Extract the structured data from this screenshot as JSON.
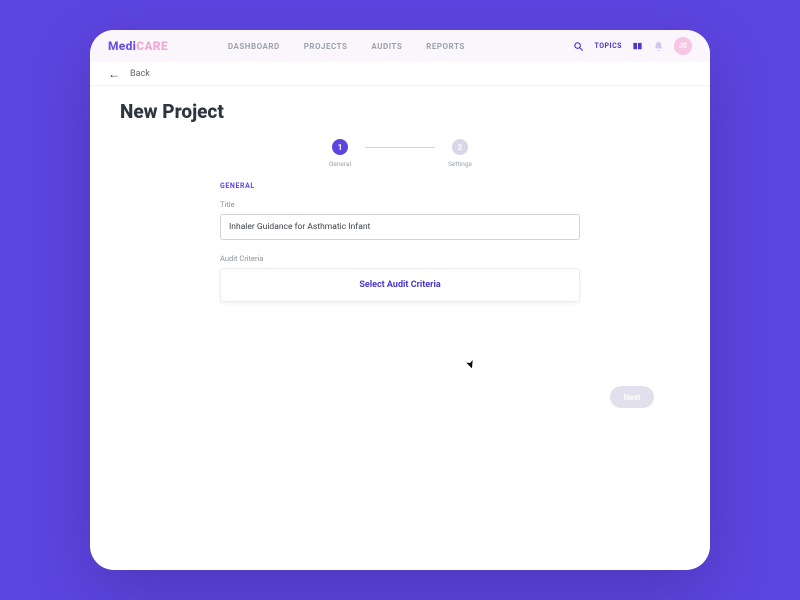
{
  "brand": {
    "part1": "Medi",
    "part2": "CARE"
  },
  "nav": {
    "dashboard": "DASHBOARD",
    "projects": "PROJECTS",
    "audits": "AUDITS",
    "reports": "REPORTS"
  },
  "header": {
    "topics": "TOPICS",
    "avatar_initials": "JS"
  },
  "back": {
    "label": "Back"
  },
  "page": {
    "title": "New Project"
  },
  "stepper": {
    "step1": {
      "num": "1",
      "label": "General"
    },
    "step2": {
      "num": "2",
      "label": "Settings"
    }
  },
  "form": {
    "section": "GENERAL",
    "title_label": "Title",
    "title_value": "Inhaler Guidance for Asthmatic Infant",
    "audit_label": "Audit Criteria",
    "audit_button": "Select Audit Criteria"
  },
  "actions": {
    "next": "Next"
  },
  "colors": {
    "accent": "#5d45e0"
  }
}
